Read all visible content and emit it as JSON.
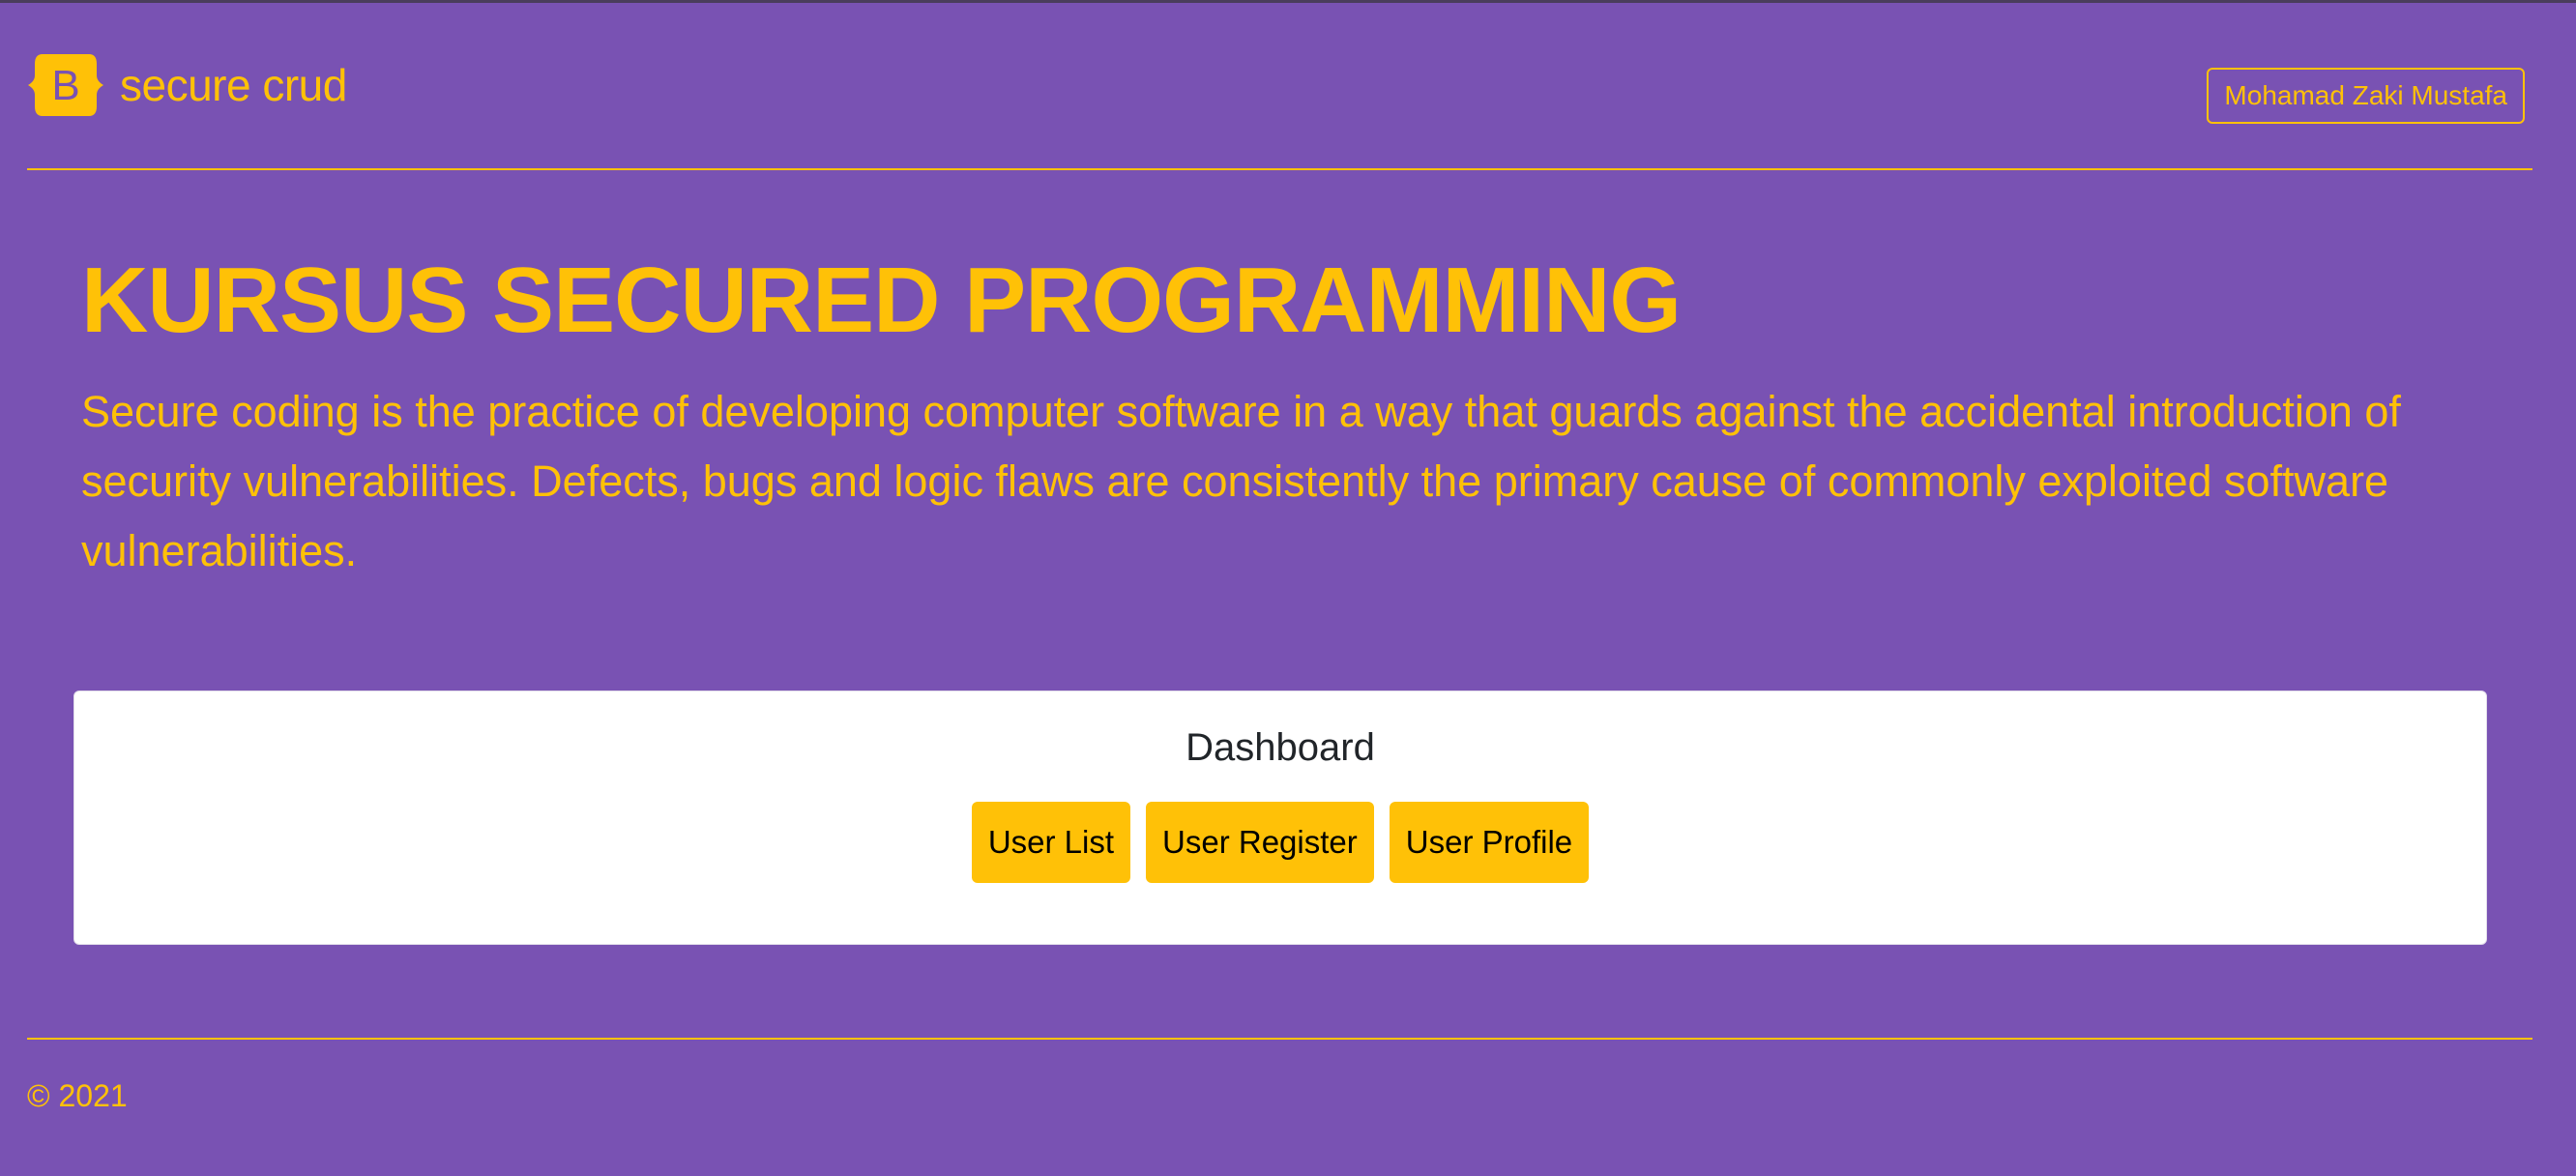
{
  "header": {
    "brand_logo_letter": "B",
    "brand_name": "secure crud",
    "user_name": "Mohamad Zaki Mustafa"
  },
  "hero": {
    "title": "KURSUS SECURED PROGRAMMING",
    "description": "Secure coding is the practice of developing computer software in a way that guards against the accidental introduction of security vulnerabilities. Defects, bugs and logic flaws are consistently the primary cause of commonly exploited software vulnerabilities."
  },
  "dashboard": {
    "title": "Dashboard",
    "buttons": [
      {
        "label": "User List"
      },
      {
        "label": "User Register"
      },
      {
        "label": "User Profile"
      }
    ]
  },
  "footer": {
    "copyright": "© 2021"
  },
  "colors": {
    "background": "#7952b3",
    "accent": "#ffc107",
    "card": "#ffffff",
    "card_title": "#212529"
  }
}
